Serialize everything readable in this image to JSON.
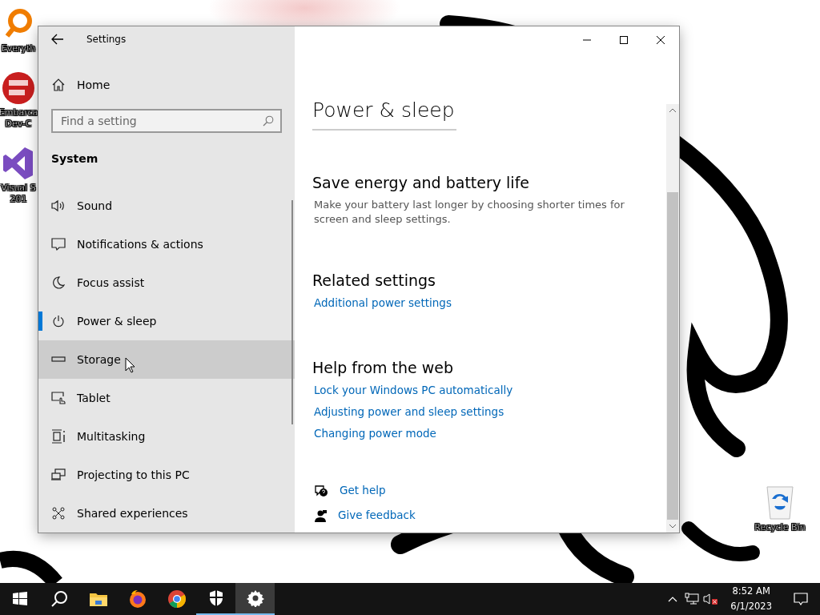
{
  "desktop": {
    "icons": [
      {
        "kind": "magnifier",
        "lines": [
          "Everyth"
        ]
      },
      {
        "kind": "devcpp",
        "lines": [
          "Embarca",
          "Dev-C"
        ]
      },
      {
        "kind": "vs",
        "lines": [
          "Visual S",
          "201"
        ]
      },
      {
        "kind": "recycle",
        "lines": [
          "Recycle Bin"
        ]
      }
    ]
  },
  "window": {
    "title": "Settings",
    "sidebar": {
      "home": "Home",
      "search": {
        "placeholder": "Find a setting"
      },
      "section": "System",
      "items": [
        {
          "kind": "sound",
          "label": "Sound",
          "selected": false,
          "hovered": false
        },
        {
          "kind": "notifications",
          "label": "Notifications & actions",
          "selected": false,
          "hovered": false
        },
        {
          "kind": "focus",
          "label": "Focus assist",
          "selected": false,
          "hovered": false
        },
        {
          "kind": "power",
          "label": "Power & sleep",
          "selected": true,
          "hovered": false
        },
        {
          "kind": "storage",
          "label": "Storage",
          "selected": false,
          "hovered": true
        },
        {
          "kind": "tablet",
          "label": "Tablet",
          "selected": false,
          "hovered": false
        },
        {
          "kind": "multitasking",
          "label": "Multitasking",
          "selected": false,
          "hovered": false
        },
        {
          "kind": "projecting",
          "label": "Projecting to this PC",
          "selected": false,
          "hovered": false
        },
        {
          "kind": "shared",
          "label": "Shared experiences",
          "selected": false,
          "hovered": false
        }
      ]
    },
    "content": {
      "heading": "Power & sleep",
      "sections": [
        {
          "title": "Save energy and battery life",
          "text": "Make your battery last longer by choosing shorter times for screen and sleep settings."
        },
        {
          "title": "Related settings",
          "links": [
            "Additional power settings"
          ]
        },
        {
          "title": "Help from the web",
          "links": [
            "Lock your Windows PC automatically",
            "Adjusting power and sleep settings",
            "Changing power mode"
          ]
        }
      ],
      "help_links": [
        {
          "kind": "help",
          "label": "Get help"
        },
        {
          "kind": "feedback",
          "label": "Give feedback"
        }
      ]
    }
  },
  "taskbar": {
    "apps": [
      {
        "kind": "start",
        "running": false,
        "active": false
      },
      {
        "kind": "search",
        "running": false,
        "active": false
      },
      {
        "kind": "explorer",
        "running": false,
        "active": false
      },
      {
        "kind": "firefox",
        "running": false,
        "active": false
      },
      {
        "kind": "chrome",
        "running": false,
        "active": false
      },
      {
        "kind": "security",
        "running": true,
        "active": false
      },
      {
        "kind": "settings",
        "running": true,
        "active": true
      }
    ],
    "clock": {
      "time": "8:52 AM",
      "date": "6/1/2023"
    }
  }
}
